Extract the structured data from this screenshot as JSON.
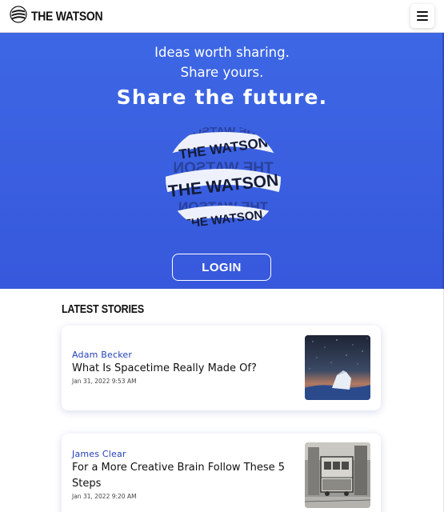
{
  "header": {
    "brand_name": "THE WATSON",
    "logo_icon": "watson-logo-icon",
    "menu_icon": "hamburger-menu-icon"
  },
  "hero": {
    "line1": "Ideas worth sharing.",
    "line2": "Share yours.",
    "title": "Share the future.",
    "globe_text": "THE WATSON",
    "login_label": "LOGIN",
    "background_color": "#3b5fe0"
  },
  "stories": {
    "section_title": "LATEST STORIES",
    "items": [
      {
        "author": "Adam Becker",
        "title": "What Is Spacetime Really Made Of?",
        "date": "Jan 31, 2022 9:53 AM",
        "thumbnail": "night-sky-photo"
      },
      {
        "author": "James Clear",
        "title": "For a More Creative Brain Follow These 5 Steps",
        "date": "Jan 31, 2022 9:20 AM",
        "thumbnail": "vintage-tram-photo"
      }
    ]
  },
  "colors": {
    "accent": "#3b5fe0",
    "author_link": "#2340b8"
  }
}
